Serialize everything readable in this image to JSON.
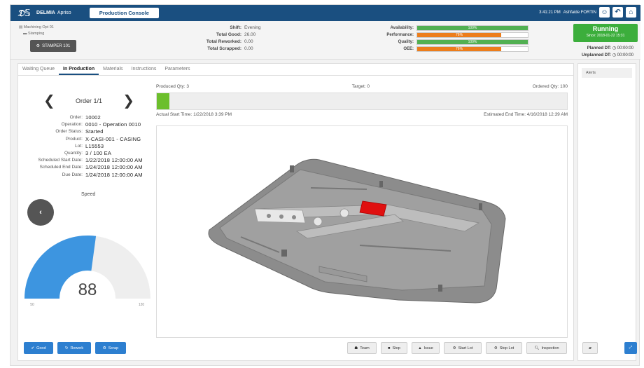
{
  "app": {
    "brand": "DELMIA",
    "brand_sub": "Apriso",
    "title": "Production Console"
  },
  "topbar": {
    "time": "3:41:21 PM",
    "user": "Ashfaide FORTIN"
  },
  "breadcrumb": {
    "level1": "Machining Opt 01",
    "level2": "Stamping"
  },
  "station": {
    "label": "STAMPER 101"
  },
  "shift": {
    "shift_label": "Shift:",
    "shift_val": "Evening",
    "good_label": "Total Good:",
    "good_val": "26.00",
    "rework_label": "Total Reworked:",
    "rework_val": "0.00",
    "scrap_label": "Total Scrapped:",
    "scrap_val": "0.00"
  },
  "kpis": [
    {
      "label": "Availability:",
      "text": "100%",
      "fill": 1.0,
      "color": "#52b052"
    },
    {
      "label": "Performance:",
      "text": "76%",
      "fill": 0.76,
      "color": "#ec7d1c"
    },
    {
      "label": "Quality:",
      "text": "100%",
      "fill": 1.0,
      "color": "#52b052"
    },
    {
      "label": "OEE:",
      "text": "76%",
      "fill": 0.76,
      "color": "#ec7d1c"
    }
  ],
  "status": {
    "label": "Running",
    "since": "Since: 2018-01-22 15:31"
  },
  "downtime": {
    "planned_label": "Planned DT:",
    "planned_val": "00:00:00",
    "unplanned_label": "Unplanned DT:",
    "unplanned_val": "00:00:00"
  },
  "tabs": [
    "Waiting Queue",
    "In Production",
    "Materials",
    "Instructions",
    "Parameters"
  ],
  "order": {
    "title": "Order 1/1",
    "fields": [
      {
        "label": "Order:",
        "value": "10002"
      },
      {
        "label": "Operation:",
        "value": "0010 - Operation 0010"
      },
      {
        "label": "Order Status:",
        "value": "Started"
      },
      {
        "label": "Product:",
        "value": "X-CASI-001 - CASING"
      },
      {
        "label": "Lot:",
        "value": "L15553"
      },
      {
        "label": "Quantity:",
        "value": "3 / 100 EA"
      },
      {
        "label": "Scheduled Start Date:",
        "value": "1/22/2018 12:00:00 AM"
      },
      {
        "label": "Scheduled End Date:",
        "value": "1/24/2018 12:00:00 AM"
      },
      {
        "label": "Due Date:",
        "value": "1/24/2018 12:00:00 AM"
      }
    ]
  },
  "speed": {
    "label": "Speed",
    "value": "88",
    "min": "50",
    "max": "120"
  },
  "production": {
    "produced": "Produced Qty: 3",
    "target": "Target: 0",
    "ordered": "Ordered Qty: 100",
    "progress": 0.03,
    "actual_start": "Actual Start Time: 1/22/2018 3:39 PM",
    "estimated_end": "Estimated End Time: 4/16/2018 12:39 AM"
  },
  "actions": {
    "good": "Good",
    "rework": "Rework",
    "scrap": "Scrap",
    "team": "Team",
    "stop": "Stop",
    "issue": "Issue",
    "start_lot": "Start Lot",
    "stop_lot": "Stop Lot",
    "inspection": "Inspection"
  },
  "alerts": {
    "title": "Alerts"
  },
  "colors": {
    "header": "#1a4f80",
    "accent": "#2d7fd0",
    "running": "#3cae3c",
    "highlight": "#e01010"
  }
}
